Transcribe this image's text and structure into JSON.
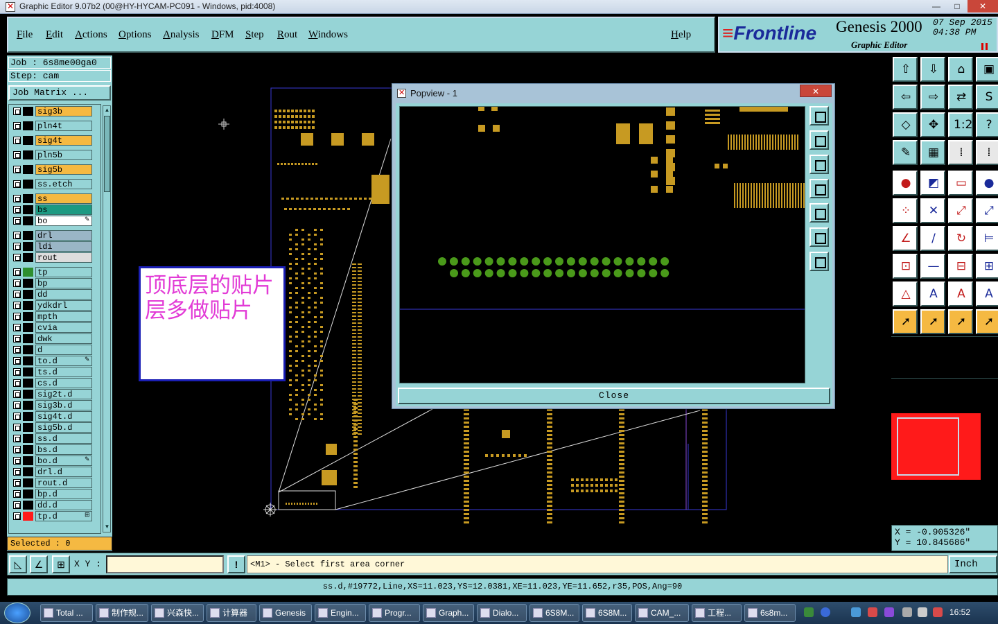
{
  "window": {
    "title": "Graphic Editor 9.07b2 (00@HY-HYCAM-PC091 - Windows, pid:4008)",
    "minimize": "—",
    "maximize": "□",
    "close": "✕"
  },
  "menu": {
    "items": [
      "File",
      "Edit",
      "Actions",
      "Options",
      "Analysis",
      "DFM",
      "Step",
      "Rout",
      "Windows"
    ],
    "help": "Help"
  },
  "brand": {
    "logo_prefix": "≡",
    "logo": "Frontline",
    "product": "Genesis 2000",
    "subtitle": "Graphic Editor",
    "date_line1": "07 Sep 2015",
    "date_line2": "04:38 PM"
  },
  "left_panel": {
    "job": "Job : 6s8me00ga0",
    "step": "Step: cam",
    "job_matrix": "Job Matrix ...",
    "selected": "Selected : 0",
    "layers": [
      {
        "name": "sig3b",
        "color": "#f5b942",
        "swatch": "#000000"
      },
      {
        "name": "pln4t",
        "color": "#96d4d6",
        "swatch": "#000000"
      },
      {
        "name": "sig4t",
        "color": "#f5b942",
        "swatch": "#000000"
      },
      {
        "name": "pln5b",
        "color": "#96d4d6",
        "swatch": "#000000"
      },
      {
        "name": "sig5b",
        "color": "#f5b942",
        "swatch": "#000000"
      },
      {
        "name": "ss.etch",
        "color": "#96d4d6",
        "swatch": "#000000"
      },
      {
        "name": "ss",
        "color": "#f5b942",
        "swatch": "#000000"
      },
      {
        "name": "bs",
        "color": "#1d9a82",
        "swatch": "#000000"
      },
      {
        "name": "bo",
        "color": "#ffffff",
        "swatch": "#000000",
        "mark": "✎"
      },
      {
        "name": "drl",
        "color": "#9ab6c6",
        "swatch": "#000000"
      },
      {
        "name": "ldi",
        "color": "#9ab6c6",
        "swatch": "#000000"
      },
      {
        "name": "rout",
        "color": "#dddddd",
        "swatch": "#000000"
      },
      {
        "name": "tp",
        "color": "#96d4d6",
        "swatch": "#2f8f2f"
      },
      {
        "name": "bp",
        "color": "#96d4d6",
        "swatch": "#000000"
      },
      {
        "name": "dd",
        "color": "#96d4d6",
        "swatch": "#000000"
      },
      {
        "name": "ydkdrl",
        "color": "#96d4d6",
        "swatch": "#000000"
      },
      {
        "name": "mpth",
        "color": "#96d4d6",
        "swatch": "#000000"
      },
      {
        "name": "cvia",
        "color": "#96d4d6",
        "swatch": "#000000"
      },
      {
        "name": "dwk",
        "color": "#96d4d6",
        "swatch": "#000000"
      },
      {
        "name": "d",
        "color": "#96d4d6",
        "swatch": "#000000"
      },
      {
        "name": "to.d",
        "color": "#96d4d6",
        "swatch": "#000000",
        "mark": "✎"
      },
      {
        "name": "ts.d",
        "color": "#96d4d6",
        "swatch": "#000000"
      },
      {
        "name": "cs.d",
        "color": "#96d4d6",
        "swatch": "#000000"
      },
      {
        "name": "sig2t.d",
        "color": "#96d4d6",
        "swatch": "#000000"
      },
      {
        "name": "sig3b.d",
        "color": "#96d4d6",
        "swatch": "#000000"
      },
      {
        "name": "sig4t.d",
        "color": "#96d4d6",
        "swatch": "#000000"
      },
      {
        "name": "sig5b.d",
        "color": "#96d4d6",
        "swatch": "#000000"
      },
      {
        "name": "ss.d",
        "color": "#96d4d6",
        "swatch": "#000000"
      },
      {
        "name": "bs.d",
        "color": "#96d4d6",
        "swatch": "#000000"
      },
      {
        "name": "bo.d",
        "color": "#96d4d6",
        "swatch": "#000000",
        "mark": "✎"
      },
      {
        "name": "drl.d",
        "color": "#96d4d6",
        "swatch": "#000000"
      },
      {
        "name": "rout.d",
        "color": "#96d4d6",
        "swatch": "#000000"
      },
      {
        "name": "bp.d",
        "color": "#96d4d6",
        "swatch": "#000000"
      },
      {
        "name": "dd.d",
        "color": "#96d4d6",
        "swatch": "#000000"
      },
      {
        "name": "tp.d",
        "color": "#96d4d6",
        "swatch": "#ff1a1a",
        "mark": "⊞"
      }
    ]
  },
  "popview": {
    "title": "Popview - 1",
    "close_x": "✕",
    "close_button": "Close"
  },
  "note": {
    "text": "顶底层的贴片层多做贴片"
  },
  "toolbox": {
    "coord_x": "X = -0.905326\"",
    "coord_y": "Y = 10.845686\""
  },
  "command_bar": {
    "xy_label": "X Y :",
    "xy_value": "",
    "alert_icon": "!",
    "message": "<M1> - Select first area corner",
    "unit": "Inch"
  },
  "status_bar": {
    "text": "ss.d,#19772,Line,XS=11.023,YS=12.0381,XE=11.023,YE=11.652,r35,POS,Ang=90"
  },
  "taskbar": {
    "tasks": [
      "Total ...",
      "制作规...",
      "兴森快...",
      "计算器",
      "Genesis",
      "Engin...",
      "Progr...",
      "Graph...",
      "Dialo...",
      "6S8M...",
      "6S8M...",
      "CAM_...",
      "工程...",
      "6s8m..."
    ],
    "clock": "16:52"
  },
  "colors": {
    "panel": "#96d4d6",
    "pad": "#c79a22",
    "green_pad": "#4a9a1a",
    "note_text": "#e23bd6",
    "note_border": "#1b1fb5"
  }
}
